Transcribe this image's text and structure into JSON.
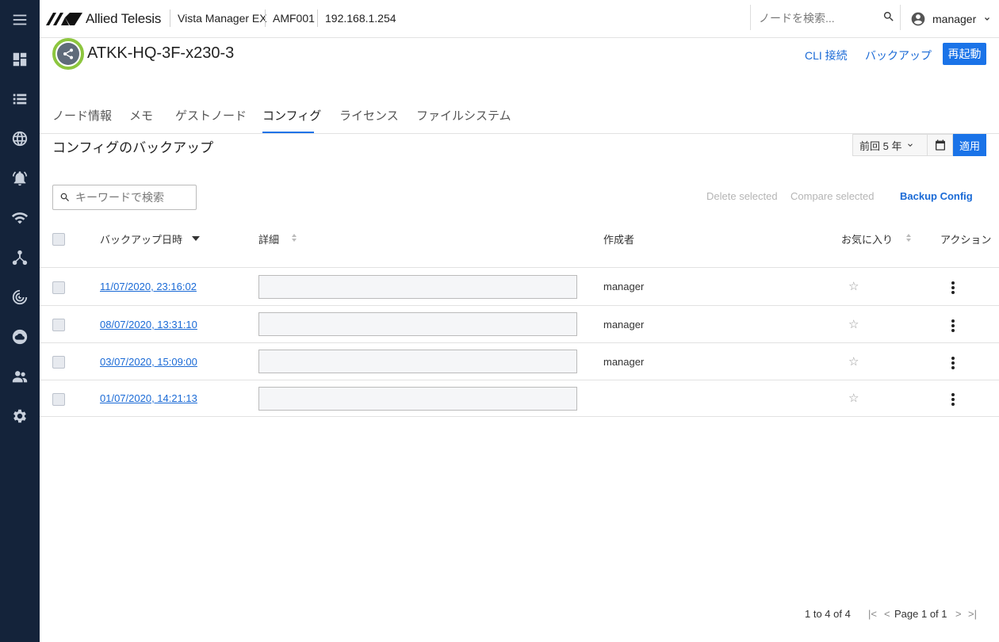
{
  "header": {
    "logo_text": "Allied Telesis",
    "app_name": "Vista Manager EX",
    "area": "AMF001",
    "ip": "192.168.1.254",
    "search_placeholder": "ノードを検索...",
    "user": "manager"
  },
  "sidebar": {
    "items": [
      "menu-icon",
      "dashboard-icon",
      "list-icon",
      "globe-icon",
      "alarm-icon",
      "wifi-icon",
      "topology-icon",
      "radar-icon",
      "cloud-icon",
      "users-icon",
      "settings-icon"
    ]
  },
  "device": {
    "name": "ATKK-HQ-3F-x230-3",
    "actions": {
      "cli": "CLI 接続",
      "backup": "バックアップ",
      "reboot": "再起動"
    }
  },
  "tabs": [
    "ノード情報",
    "メモ",
    "ゲストノード",
    "コンフィグ",
    "ライセンス",
    "ファイルシステム"
  ],
  "active_tab": "コンフィグ",
  "section": {
    "title": "コンフィグのバックアップ",
    "range": "前回 5 年",
    "apply": "適用",
    "keyword_placeholder": "キーワードで検索",
    "delete_selected": "Delete selected",
    "compare_selected": "Compare selected",
    "backup_config": "Backup Config"
  },
  "table": {
    "columns": [
      "バックアップ日時",
      "詳細",
      "作成者",
      "お気に入り",
      "アクション"
    ],
    "rows": [
      {
        "date": "11/07/2020, 23:16:02",
        "detail": "",
        "author": "manager",
        "favorite": "☆"
      },
      {
        "date": "08/07/2020, 13:31:10",
        "detail": "",
        "author": "manager",
        "favorite": "☆"
      },
      {
        "date": "03/07/2020, 15:09:00",
        "detail": "",
        "author": "manager",
        "favorite": "☆"
      },
      {
        "date": "01/07/2020, 14:21:13",
        "detail": "",
        "author": "",
        "favorite": "☆"
      }
    ]
  },
  "pagination": {
    "summary": "1 to 4 of 4",
    "page_text": "Page 1 of 1",
    "first": "|<",
    "prev": "<",
    "next": ">",
    "last": ">|"
  },
  "colors": {
    "sidebar": "#14233a",
    "accent": "#1a73e8",
    "device_ring": "#8dc63f"
  }
}
